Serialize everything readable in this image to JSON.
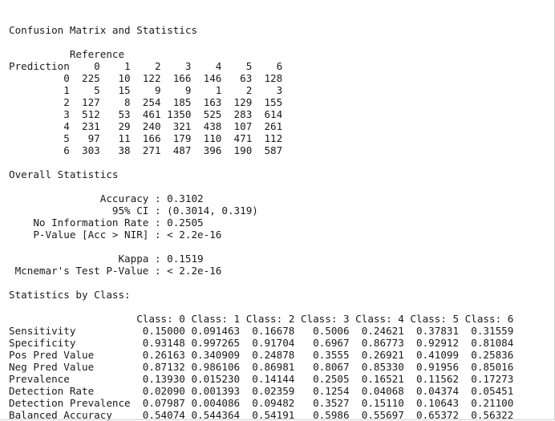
{
  "console": {
    "lines": [
      "",
      "Confusion Matrix and Statistics",
      "",
      "          Reference",
      "Prediction    0    1    2    3    4    5    6",
      "         0  225   10  122  166  146   63  128",
      "         1    5   15    9    9    1    2    3",
      "         2  127    8  254  185  163  129  155",
      "         3  512   53  461 1350  525  283  614",
      "         4  231   29  240  321  438  107  261",
      "         5   97   11  166  179  110  471  112",
      "         6  303   38  271  487  396  190  587",
      "",
      "Overall Statistics",
      "",
      "               Accuracy : 0.3102",
      "                 95% CI : (0.3014, 0.319)",
      "    No Information Rate : 0.2505",
      "    P-Value [Acc > NIR] : < 2.2e-16",
      "",
      "                  Kappa : 0.1519",
      " Mcnemar's Test P-Value : < 2.2e-16",
      "",
      "Statistics by Class:",
      "",
      "                     Class: 0 Class: 1 Class: 2 Class: 3 Class: 4 Class: 5 Class: 6",
      "Sensitivity           0.15000 0.091463  0.16678   0.5006  0.24621  0.37831  0.31559",
      "Specificity           0.93148 0.997265  0.91704   0.6967  0.86773  0.92912  0.81084",
      "Pos Pred Value        0.26163 0.340909  0.24878   0.3555  0.26921  0.41099  0.25836",
      "Neg Pred Value        0.87132 0.986106  0.86981   0.8067  0.85330  0.91956  0.85016",
      "Prevalence            0.13930 0.015230  0.14144   0.2505  0.16521  0.11562  0.17273",
      "Detection Rate        0.02090 0.001393  0.02359   0.1254  0.04068  0.04374  0.05451",
      "Detection Prevalence  0.07987 0.004086  0.09482   0.3527  0.15110  0.10643  0.21100",
      "Balanced Accuracy     0.54074 0.544364  0.54191   0.5986  0.55697  0.65372  0.56322"
    ]
  }
}
